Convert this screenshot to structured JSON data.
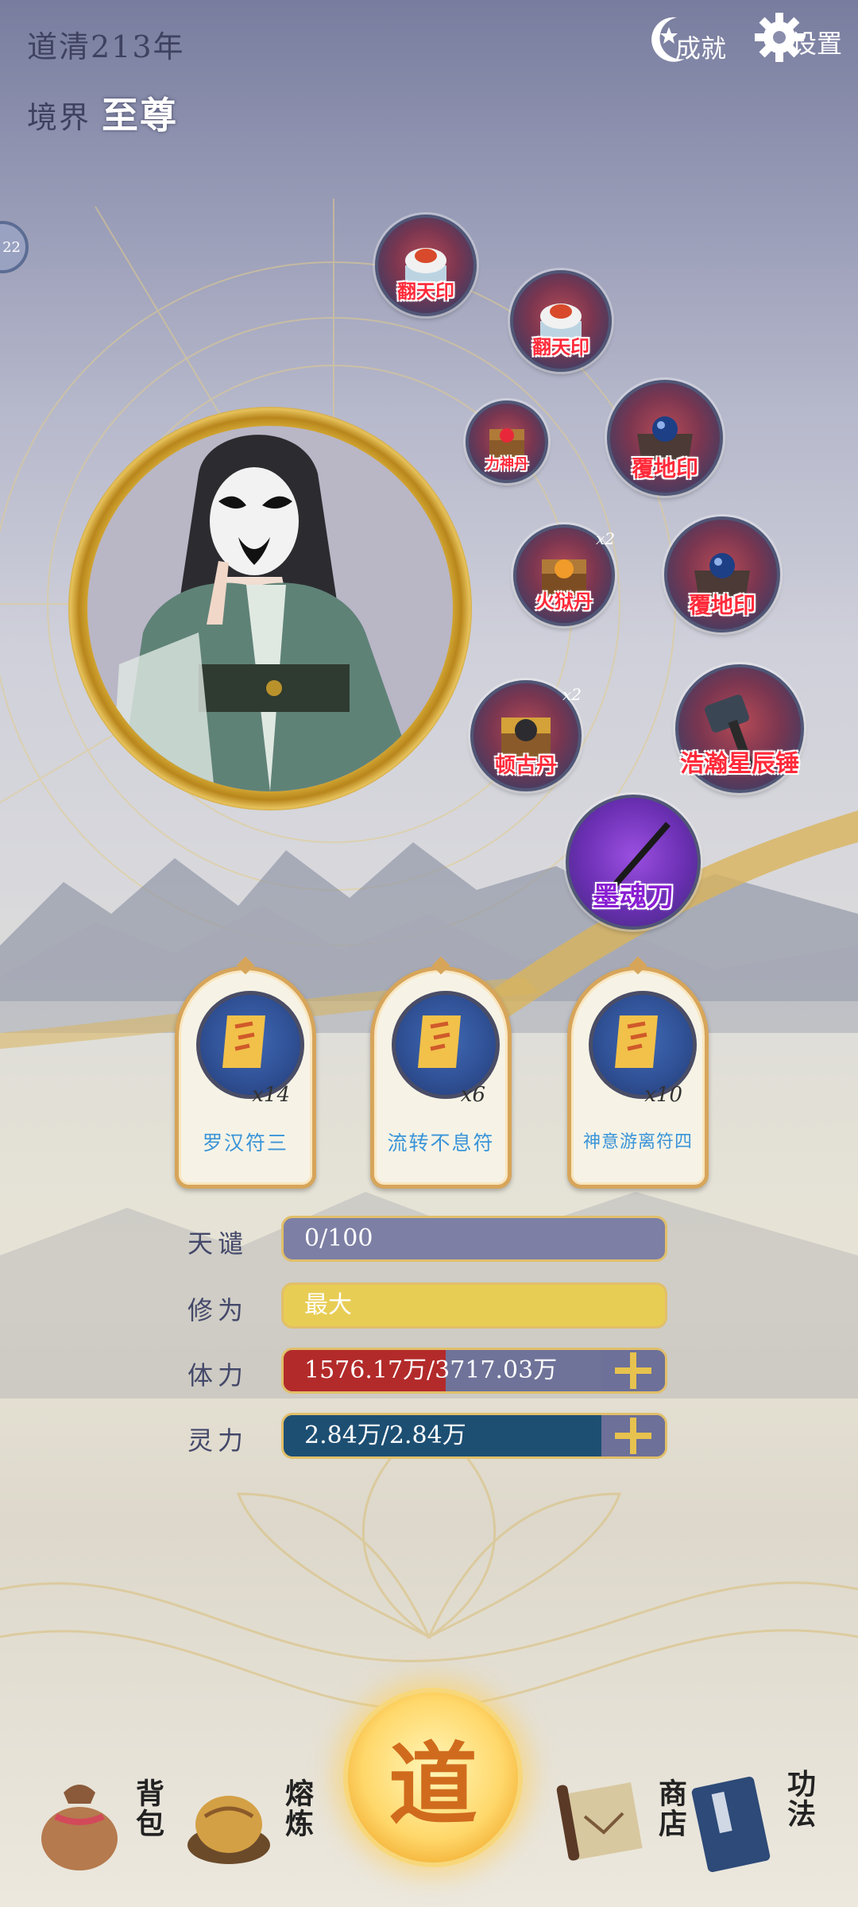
{
  "header": {
    "era": "道清213年",
    "realm_label": "境界",
    "realm_value": "至尊",
    "achievements": "成就",
    "settings": "设置"
  },
  "side_bubble": "22",
  "equipment": [
    {
      "name": "翻天印",
      "icon": "seal-icon"
    },
    {
      "name": "翻天印",
      "icon": "seal-icon"
    },
    {
      "name": "力神丹",
      "icon": "pill-chest-icon"
    },
    {
      "name": "覆地印",
      "icon": "orb-seal-icon"
    },
    {
      "name": "火狱丹",
      "icon": "pill-chest-icon",
      "count": "x2"
    },
    {
      "name": "覆地印",
      "icon": "orb-seal-icon"
    },
    {
      "name": "顿古丹",
      "icon": "pill-chest-icon",
      "count": "x2"
    },
    {
      "name": "浩瀚星辰锤",
      "icon": "hammer-icon"
    },
    {
      "name": "墨魂刀",
      "icon": "sword-icon"
    }
  ],
  "talismans": [
    {
      "name": "罗汉符三",
      "count": "x14"
    },
    {
      "name": "流转不息符",
      "count": "x6"
    },
    {
      "name": "神意游离符四",
      "count": "x10"
    }
  ],
  "stats": {
    "tianqian": {
      "label": "天谴",
      "value": "0/100"
    },
    "xiuwei": {
      "label": "修为",
      "value": "最大"
    },
    "tili": {
      "label": "体力",
      "value": "1576.17万/3717.03万",
      "fraction": 0.424
    },
    "lingli": {
      "label": "灵力",
      "value": "2.84万/2.84万",
      "fraction": 1.0
    }
  },
  "nav": {
    "bag": "背包",
    "refine": "熔炼",
    "dao": "道",
    "shop": "商店",
    "skills": "功法"
  },
  "colors": {
    "item_label_red": "#ff2a3a",
    "item_label_purple": "#8a1fd2",
    "gold": "#e1bf6a",
    "tianqian_bar": "#7d7fa5",
    "xiuwei_bar": "#e8cd55",
    "tili_fill": "#b32a2a",
    "tili_bg": "#6f7399",
    "lingli_bar": "#1d4f73"
  }
}
